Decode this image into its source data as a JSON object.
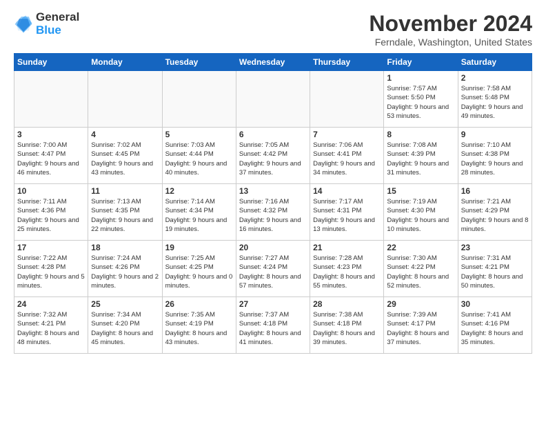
{
  "header": {
    "logo_line1": "General",
    "logo_line2": "Blue",
    "month": "November 2024",
    "location": "Ferndale, Washington, United States"
  },
  "days_of_week": [
    "Sunday",
    "Monday",
    "Tuesday",
    "Wednesday",
    "Thursday",
    "Friday",
    "Saturday"
  ],
  "weeks": [
    [
      {
        "num": "",
        "info": ""
      },
      {
        "num": "",
        "info": ""
      },
      {
        "num": "",
        "info": ""
      },
      {
        "num": "",
        "info": ""
      },
      {
        "num": "",
        "info": ""
      },
      {
        "num": "1",
        "info": "Sunrise: 7:57 AM\nSunset: 5:50 PM\nDaylight: 9 hours and 53 minutes."
      },
      {
        "num": "2",
        "info": "Sunrise: 7:58 AM\nSunset: 5:48 PM\nDaylight: 9 hours and 49 minutes."
      }
    ],
    [
      {
        "num": "3",
        "info": "Sunrise: 7:00 AM\nSunset: 4:47 PM\nDaylight: 9 hours and 46 minutes."
      },
      {
        "num": "4",
        "info": "Sunrise: 7:02 AM\nSunset: 4:45 PM\nDaylight: 9 hours and 43 minutes."
      },
      {
        "num": "5",
        "info": "Sunrise: 7:03 AM\nSunset: 4:44 PM\nDaylight: 9 hours and 40 minutes."
      },
      {
        "num": "6",
        "info": "Sunrise: 7:05 AM\nSunset: 4:42 PM\nDaylight: 9 hours and 37 minutes."
      },
      {
        "num": "7",
        "info": "Sunrise: 7:06 AM\nSunset: 4:41 PM\nDaylight: 9 hours and 34 minutes."
      },
      {
        "num": "8",
        "info": "Sunrise: 7:08 AM\nSunset: 4:39 PM\nDaylight: 9 hours and 31 minutes."
      },
      {
        "num": "9",
        "info": "Sunrise: 7:10 AM\nSunset: 4:38 PM\nDaylight: 9 hours and 28 minutes."
      }
    ],
    [
      {
        "num": "10",
        "info": "Sunrise: 7:11 AM\nSunset: 4:36 PM\nDaylight: 9 hours and 25 minutes."
      },
      {
        "num": "11",
        "info": "Sunrise: 7:13 AM\nSunset: 4:35 PM\nDaylight: 9 hours and 22 minutes."
      },
      {
        "num": "12",
        "info": "Sunrise: 7:14 AM\nSunset: 4:34 PM\nDaylight: 9 hours and 19 minutes."
      },
      {
        "num": "13",
        "info": "Sunrise: 7:16 AM\nSunset: 4:32 PM\nDaylight: 9 hours and 16 minutes."
      },
      {
        "num": "14",
        "info": "Sunrise: 7:17 AM\nSunset: 4:31 PM\nDaylight: 9 hours and 13 minutes."
      },
      {
        "num": "15",
        "info": "Sunrise: 7:19 AM\nSunset: 4:30 PM\nDaylight: 9 hours and 10 minutes."
      },
      {
        "num": "16",
        "info": "Sunrise: 7:21 AM\nSunset: 4:29 PM\nDaylight: 9 hours and 8 minutes."
      }
    ],
    [
      {
        "num": "17",
        "info": "Sunrise: 7:22 AM\nSunset: 4:28 PM\nDaylight: 9 hours and 5 minutes."
      },
      {
        "num": "18",
        "info": "Sunrise: 7:24 AM\nSunset: 4:26 PM\nDaylight: 9 hours and 2 minutes."
      },
      {
        "num": "19",
        "info": "Sunrise: 7:25 AM\nSunset: 4:25 PM\nDaylight: 9 hours and 0 minutes."
      },
      {
        "num": "20",
        "info": "Sunrise: 7:27 AM\nSunset: 4:24 PM\nDaylight: 8 hours and 57 minutes."
      },
      {
        "num": "21",
        "info": "Sunrise: 7:28 AM\nSunset: 4:23 PM\nDaylight: 8 hours and 55 minutes."
      },
      {
        "num": "22",
        "info": "Sunrise: 7:30 AM\nSunset: 4:22 PM\nDaylight: 8 hours and 52 minutes."
      },
      {
        "num": "23",
        "info": "Sunrise: 7:31 AM\nSunset: 4:21 PM\nDaylight: 8 hours and 50 minutes."
      }
    ],
    [
      {
        "num": "24",
        "info": "Sunrise: 7:32 AM\nSunset: 4:21 PM\nDaylight: 8 hours and 48 minutes."
      },
      {
        "num": "25",
        "info": "Sunrise: 7:34 AM\nSunset: 4:20 PM\nDaylight: 8 hours and 45 minutes."
      },
      {
        "num": "26",
        "info": "Sunrise: 7:35 AM\nSunset: 4:19 PM\nDaylight: 8 hours and 43 minutes."
      },
      {
        "num": "27",
        "info": "Sunrise: 7:37 AM\nSunset: 4:18 PM\nDaylight: 8 hours and 41 minutes."
      },
      {
        "num": "28",
        "info": "Sunrise: 7:38 AM\nSunset: 4:18 PM\nDaylight: 8 hours and 39 minutes."
      },
      {
        "num": "29",
        "info": "Sunrise: 7:39 AM\nSunset: 4:17 PM\nDaylight: 8 hours and 37 minutes."
      },
      {
        "num": "30",
        "info": "Sunrise: 7:41 AM\nSunset: 4:16 PM\nDaylight: 8 hours and 35 minutes."
      }
    ]
  ]
}
